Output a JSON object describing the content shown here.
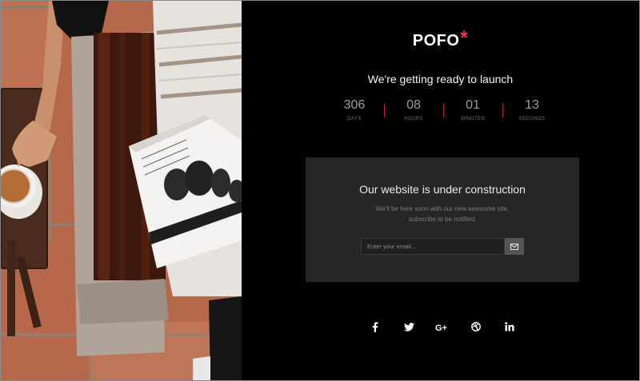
{
  "brand": {
    "name": "POFO",
    "mark": "*",
    "accent_color": "#f0304c"
  },
  "headline": "We're getting ready to launch",
  "countdown": [
    {
      "value": "306",
      "label": "DAYS"
    },
    {
      "value": "08",
      "label": "HOURS"
    },
    {
      "value": "01",
      "label": "MINUTES"
    },
    {
      "value": "13",
      "label": "SECONDS"
    }
  ],
  "panel": {
    "title": "Our website is under construction",
    "text_line1": "We'll be here soon with our new awesome site,",
    "text_line2": "subscribe to be notified.",
    "email_placeholder": "Enter your email...",
    "submit_icon": "envelope-icon"
  },
  "social": [
    {
      "name": "facebook-icon"
    },
    {
      "name": "twitter-icon"
    },
    {
      "name": "google-plus-icon"
    },
    {
      "name": "dribbble-icon"
    },
    {
      "name": "linkedin-icon"
    }
  ],
  "photo": {
    "subject": "coffee-and-magazine-photo"
  }
}
